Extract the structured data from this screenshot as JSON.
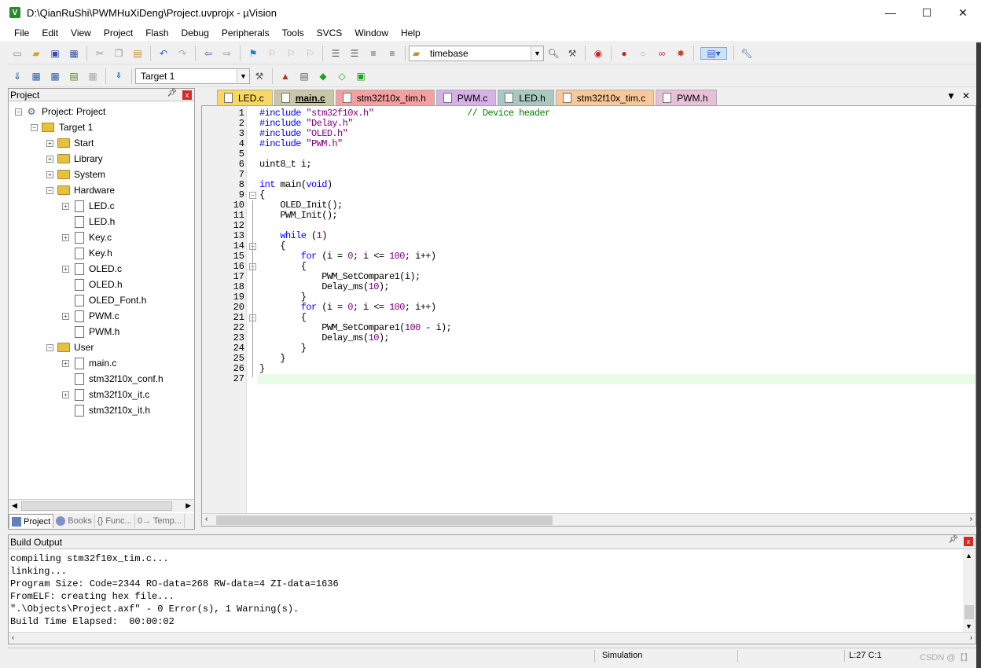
{
  "window": {
    "title": "D:\\QianRuShi\\PWMHuXiDeng\\Project.uvprojx - µVision",
    "app_icon_letter": "V",
    "controls": [
      "—",
      "☐",
      "✕"
    ]
  },
  "menu": [
    "File",
    "Edit",
    "View",
    "Project",
    "Flash",
    "Debug",
    "Peripherals",
    "Tools",
    "SVCS",
    "Window",
    "Help"
  ],
  "toolbar1": {
    "find_combo_value": "timebase"
  },
  "toolbar2": {
    "target_combo_value": "Target 1"
  },
  "project_panel": {
    "title": "Project",
    "pin": "ᵖ",
    "close": "x",
    "tree": [
      {
        "label": "Project: Project",
        "level": 0,
        "type": "project",
        "expander": "−"
      },
      {
        "label": "Target 1",
        "level": 1,
        "type": "target",
        "expander": "−"
      },
      {
        "label": "Start",
        "level": 2,
        "type": "folder",
        "expander": "+"
      },
      {
        "label": "Library",
        "level": 2,
        "type": "folder",
        "expander": "+"
      },
      {
        "label": "System",
        "level": 2,
        "type": "folder",
        "expander": "+"
      },
      {
        "label": "Hardware",
        "level": 2,
        "type": "folder",
        "expander": "−"
      },
      {
        "label": "LED.c",
        "level": 3,
        "type": "file",
        "expander": "+"
      },
      {
        "label": "LED.h",
        "level": 3,
        "type": "file",
        "expander": ""
      },
      {
        "label": "Key.c",
        "level": 3,
        "type": "file",
        "expander": "+"
      },
      {
        "label": "Key.h",
        "level": 3,
        "type": "file",
        "expander": ""
      },
      {
        "label": "OLED.c",
        "level": 3,
        "type": "file",
        "expander": "+"
      },
      {
        "label": "OLED.h",
        "level": 3,
        "type": "file",
        "expander": ""
      },
      {
        "label": "OLED_Font.h",
        "level": 3,
        "type": "file",
        "expander": ""
      },
      {
        "label": "PWM.c",
        "level": 3,
        "type": "file",
        "expander": "+"
      },
      {
        "label": "PWM.h",
        "level": 3,
        "type": "file",
        "expander": ""
      },
      {
        "label": "User",
        "level": 2,
        "type": "folder",
        "expander": "−"
      },
      {
        "label": "main.c",
        "level": 3,
        "type": "file",
        "expander": "+"
      },
      {
        "label": "stm32f10x_conf.h",
        "level": 3,
        "type": "file",
        "expander": ""
      },
      {
        "label": "stm32f10x_it.c",
        "level": 3,
        "type": "file",
        "expander": "+"
      },
      {
        "label": "stm32f10x_it.h",
        "level": 3,
        "type": "file",
        "expander": ""
      }
    ],
    "bottom_tabs": [
      "Project",
      "Books",
      "{} Func...",
      "0→ Temp..."
    ]
  },
  "editor": {
    "tabs": [
      {
        "label": "LED.c",
        "color": "#f8d860",
        "active": false
      },
      {
        "label": "main.c",
        "color": "#c8c8a8",
        "active": true
      },
      {
        "label": "stm32f10x_tim.h",
        "color": "#f4a0a0",
        "active": false
      },
      {
        "label": "PWM.c",
        "color": "#d8b0e8",
        "active": false
      },
      {
        "label": "LED.h",
        "color": "#a8c8c0",
        "active": false
      },
      {
        "label": "stm32f10x_tim.c",
        "color": "#f8c898",
        "active": false
      },
      {
        "label": "PWM.h",
        "color": "#e8c0d8",
        "active": false
      }
    ],
    "active_line": 27,
    "lines": [
      [
        [
          "pp",
          "#include "
        ],
        [
          "str",
          "\"stm32f10x.h\""
        ],
        [
          "",
          "                  "
        ],
        [
          "cmt",
          "// Device header"
        ]
      ],
      [
        [
          "pp",
          "#include "
        ],
        [
          "str",
          "\"Delay.h\""
        ]
      ],
      [
        [
          "pp",
          "#include "
        ],
        [
          "str",
          "\"OLED.h\""
        ]
      ],
      [
        [
          "pp",
          "#include "
        ],
        [
          "str",
          "\"PWM.h\""
        ]
      ],
      [],
      [
        [
          "",
          "uint8_t i;"
        ]
      ],
      [],
      [
        [
          "kw",
          "int"
        ],
        [
          "",
          " main("
        ],
        [
          "kw",
          "void"
        ],
        [
          "",
          ")"
        ]
      ],
      [
        [
          "",
          "{"
        ]
      ],
      [
        [
          "",
          "    OLED_Init();"
        ]
      ],
      [
        [
          "",
          "    PWM_Init();"
        ]
      ],
      [],
      [
        [
          "kw",
          "    while"
        ],
        [
          "",
          " ("
        ],
        [
          "num",
          "1"
        ],
        [
          "",
          ")"
        ]
      ],
      [
        [
          "",
          "    {"
        ]
      ],
      [
        [
          "kw",
          "        for"
        ],
        [
          "",
          " (i = "
        ],
        [
          "num",
          "0"
        ],
        [
          "",
          "; i <= "
        ],
        [
          "num",
          "100"
        ],
        [
          "",
          "; i++)"
        ]
      ],
      [
        [
          "",
          "        {"
        ]
      ],
      [
        [
          "",
          "            PWM_SetCompare1(i);"
        ]
      ],
      [
        [
          "",
          "            Delay_ms("
        ],
        [
          "num",
          "10"
        ],
        [
          "",
          ");"
        ]
      ],
      [
        [
          "",
          "        }"
        ]
      ],
      [
        [
          "kw",
          "        for"
        ],
        [
          "",
          " (i = "
        ],
        [
          "num",
          "0"
        ],
        [
          "",
          "; i <= "
        ],
        [
          "num",
          "100"
        ],
        [
          "",
          "; i++)"
        ]
      ],
      [
        [
          "",
          "        {"
        ]
      ],
      [
        [
          "",
          "            PWM_SetCompare1("
        ],
        [
          "num",
          "100"
        ],
        [
          "",
          " - i);"
        ]
      ],
      [
        [
          "",
          "            Delay_ms("
        ],
        [
          "num",
          "10"
        ],
        [
          "",
          ");"
        ]
      ],
      [
        [
          "",
          "        }"
        ]
      ],
      [
        [
          "",
          "    }"
        ]
      ],
      [
        [
          "",
          "}"
        ]
      ],
      []
    ]
  },
  "build_output": {
    "title": "Build Output",
    "lines": [
      "compiling stm32f10x_tim.c...",
      "linking...",
      "Program Size: Code=2344 RO-data=268 RW-data=4 ZI-data=1636",
      "FromELF: creating hex file...",
      "\".\\Objects\\Project.axf\" - 0 Error(s), 1 Warning(s).",
      "Build Time Elapsed:  00:00:02"
    ]
  },
  "status": {
    "mode": "Simulation",
    "position": "L:27 C:1",
    "watermark": "CSDN @【】"
  }
}
